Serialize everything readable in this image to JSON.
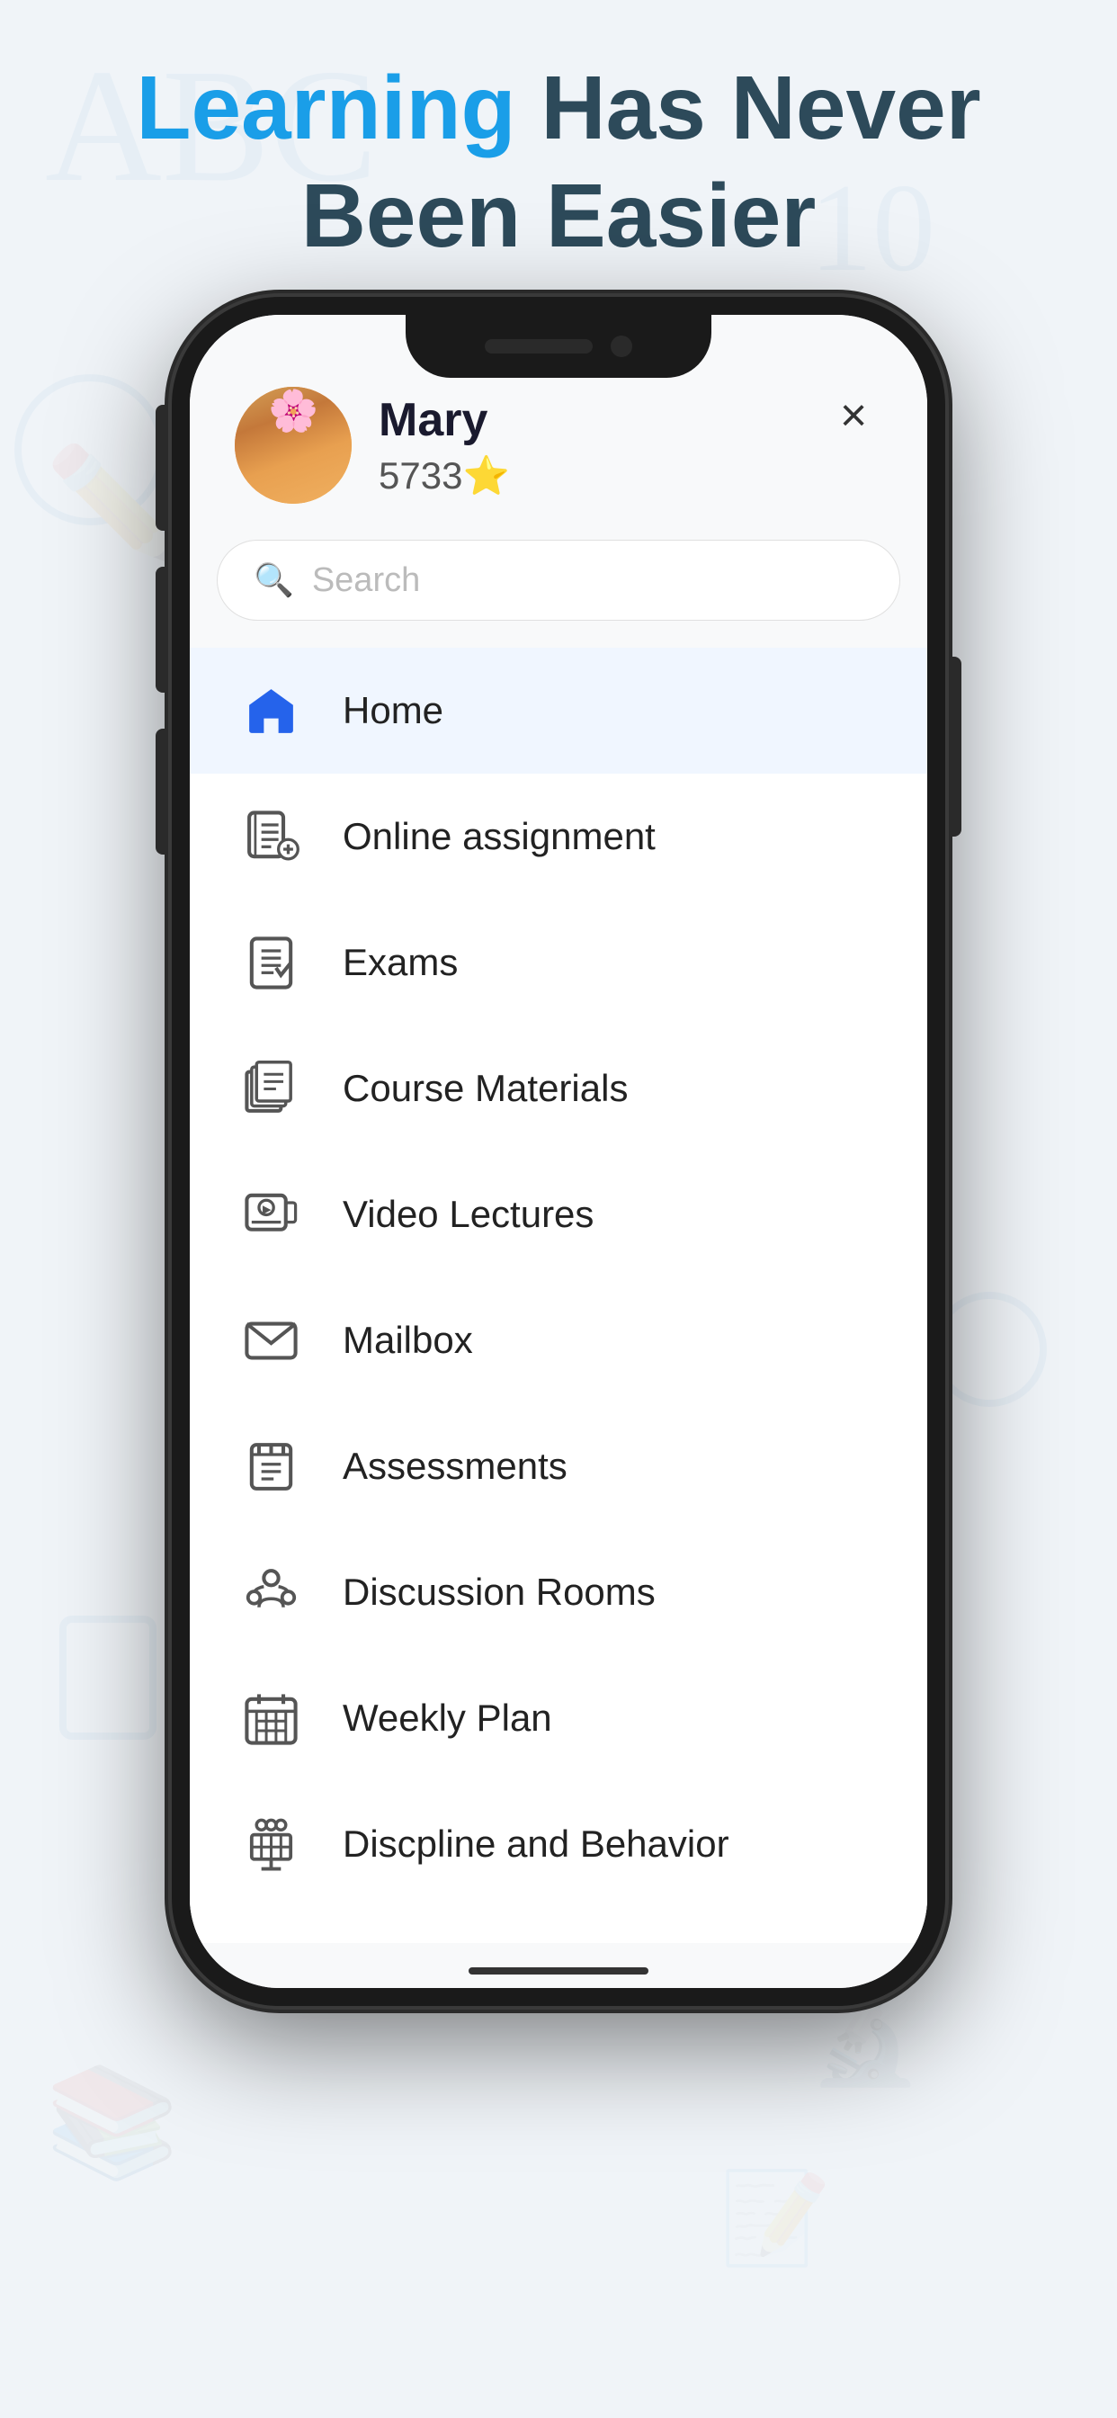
{
  "header": {
    "line1_blue": "Learning",
    "line1_rest": " Has Never",
    "line2": "Been Easier"
  },
  "close_button": "×",
  "user": {
    "name": "Mary",
    "points": "5733",
    "star": "⭐"
  },
  "search": {
    "placeholder": "Search"
  },
  "menu": {
    "items": [
      {
        "id": "home",
        "label": "Home",
        "active": true
      },
      {
        "id": "online-assignment",
        "label": "Online assignment",
        "active": false
      },
      {
        "id": "exams",
        "label": "Exams",
        "active": false
      },
      {
        "id": "course-materials",
        "label": "Course Materials",
        "active": false
      },
      {
        "id": "video-lectures",
        "label": "Video Lectures",
        "active": false
      },
      {
        "id": "mailbox",
        "label": "Mailbox",
        "active": false
      },
      {
        "id": "assessments",
        "label": "Assessments",
        "active": false
      },
      {
        "id": "discussion-rooms",
        "label": "Discussion Rooms",
        "active": false
      },
      {
        "id": "weekly-plan",
        "label": "Weekly Plan",
        "active": false
      },
      {
        "id": "discipline-behavior",
        "label": "Discpline and Behavior",
        "active": false
      }
    ]
  }
}
